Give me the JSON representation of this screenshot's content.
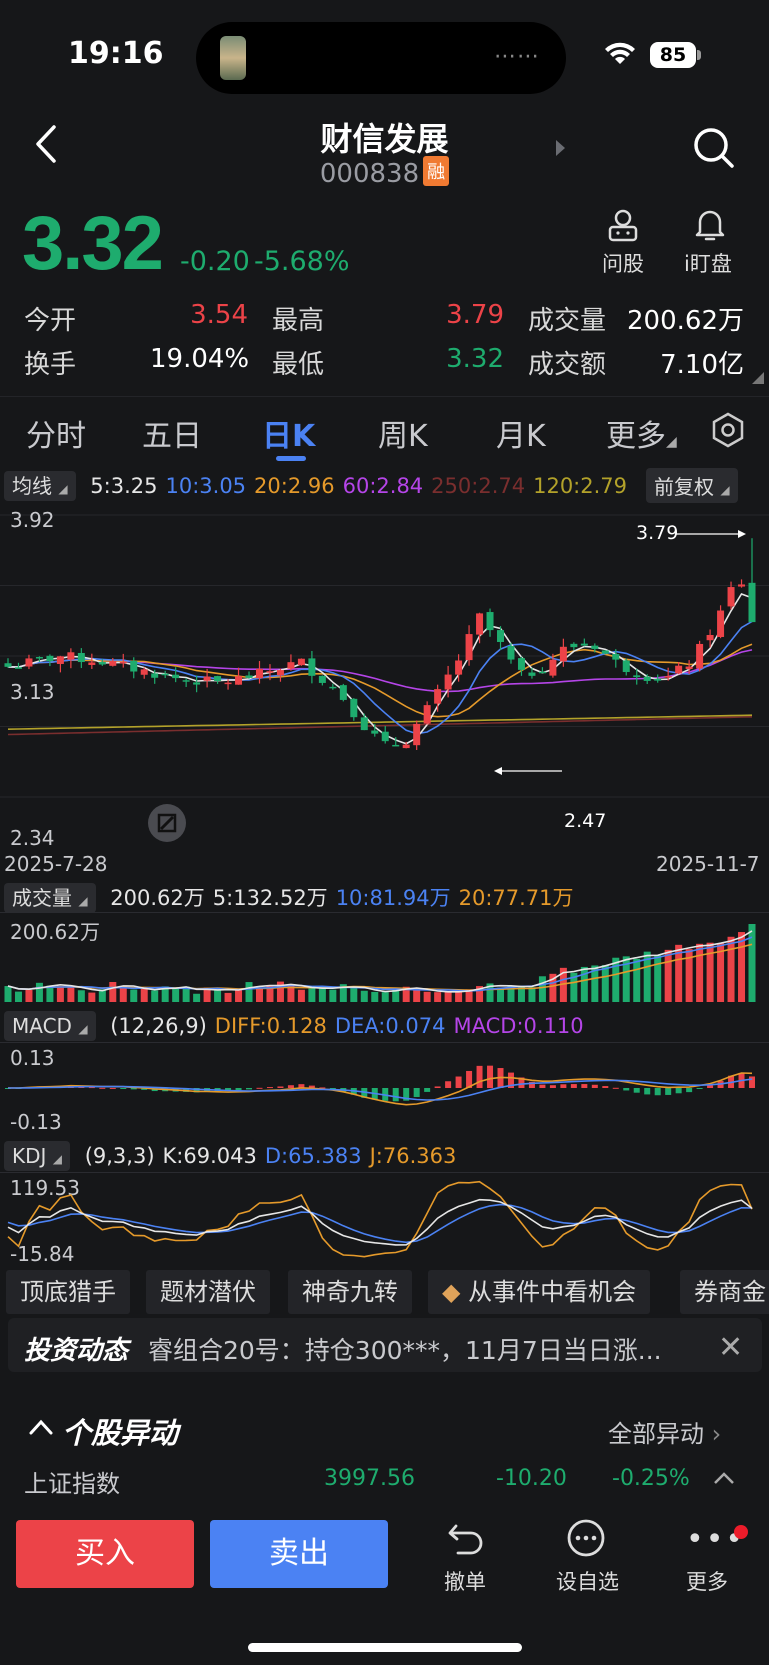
{
  "status": {
    "time": "19:16",
    "battery": "85"
  },
  "header": {
    "title": "财信发展",
    "code": "000838",
    "badge": "融"
  },
  "quote": {
    "price": "3.32",
    "change": "-0.20",
    "change_pct": "-5.68%",
    "open_label": "今开",
    "open": "3.54",
    "high_label": "最高",
    "high": "3.79",
    "volume_label": "成交量",
    "volume": "200.62万",
    "turnover_label": "换手",
    "turnover": "19.04%",
    "low_label": "最低",
    "low": "3.32",
    "amount_label": "成交额",
    "amount": "7.10亿"
  },
  "actions": {
    "ask_label": "问股",
    "watch_label": "i盯盘"
  },
  "tabs": [
    "分时",
    "五日",
    "日K",
    "周K",
    "月K",
    "更多"
  ],
  "active_tab": "日K",
  "ma_row": {
    "selector": "均线",
    "items": [
      {
        "label": "5:3.25",
        "color": "#e6e6e6"
      },
      {
        "label": "10:3.05",
        "color": "#4b82f3"
      },
      {
        "label": "20:2.96",
        "color": "#e59a2b"
      },
      {
        "label": "60:2.84",
        "color": "#b545e8"
      },
      {
        "label": "250:2.74",
        "color": "#7a2e2e"
      },
      {
        "label": "120:2.79",
        "color": "#b3a22a"
      }
    ],
    "adjust": "前复权"
  },
  "kline": {
    "y_top": "3.92",
    "y_mid": "3.13",
    "y_bottom": "2.34",
    "high_mark": "3.79",
    "low_mark": "2.47",
    "date_start": "2025-7-28",
    "date_end": "2025-11-7"
  },
  "volume_row": {
    "selector": "成交量",
    "items": [
      {
        "label": "200.62万",
        "color": "#e6e6e6"
      },
      {
        "label": "5:132.52万",
        "color": "#e6e6e6"
      },
      {
        "label": "10:81.94万",
        "color": "#4b82f3"
      },
      {
        "label": "20:77.71万",
        "color": "#e59a2b"
      }
    ],
    "axis_top": "200.62万"
  },
  "macd_row": {
    "selector": "MACD",
    "items": [
      {
        "label": "(12,26,9)",
        "color": "#e6e6e6"
      },
      {
        "label": "DIFF:0.128",
        "color": "#e59a2b"
      },
      {
        "label": "DEA:0.074",
        "color": "#4b82f3"
      },
      {
        "label": "MACD:0.110",
        "color": "#b545e8"
      }
    ],
    "axis_top": "0.13",
    "axis_bottom": "-0.13"
  },
  "kdj_row": {
    "selector": "KDJ",
    "items": [
      {
        "label": "(9,3,3)",
        "color": "#e6e6e6"
      },
      {
        "label": "K:69.043",
        "color": "#e6e6e6"
      },
      {
        "label": "D:65.383",
        "color": "#4b82f3"
      },
      {
        "label": "J:76.363",
        "color": "#e59a2b"
      }
    ],
    "axis_top": "119.53",
    "axis_bottom": "-15.84"
  },
  "features": [
    "顶底猎手",
    "题材潜伏",
    "神奇九转",
    "从事件中看机会",
    "券商金"
  ],
  "news": {
    "tag": "投资动态",
    "text": "睿组合20号：持仓300***，11月7日当日涨..."
  },
  "section": {
    "title": "个股异动",
    "more": "全部异动"
  },
  "index_row": {
    "name": "上证指数",
    "value": "3997.56",
    "change": "-10.20",
    "pct": "-0.25%"
  },
  "bottom": {
    "buy": "买入",
    "sell": "卖出",
    "undo": "撤单",
    "watchlist": "设自选",
    "more": "更多"
  },
  "colors": {
    "up": "#ec4348",
    "down": "#1eac6e",
    "accent": "#4b82f3"
  }
}
